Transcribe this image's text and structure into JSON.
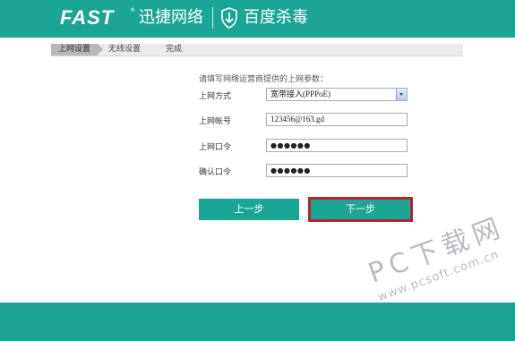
{
  "header": {
    "logo": "FAST",
    "trademark": "®",
    "brand_cn": "迅捷网络",
    "partner": "百度杀毒",
    "color": "#1aa595"
  },
  "steps": [
    "上网设置",
    "无线设置",
    "完成"
  ],
  "instruction": "请填写网络运营商提供的上网参数：",
  "form": {
    "mode_label": "上网方式",
    "mode_value": "宽带接入(PPPoE)",
    "account_label": "上网帐号",
    "account_value": "123456@163.gd",
    "password_label": "上网口令",
    "password_value": "●●●●●●",
    "confirm_label": "确认口令",
    "confirm_value": "●●●●●●"
  },
  "buttons": {
    "prev": "上一步",
    "next": "下一步"
  },
  "watermark": {
    "line1": "PC下载网",
    "line2": "www.pcsoft.com.cn"
  },
  "colors": {
    "accent": "#1aa595",
    "highlight_border": "#b32630"
  }
}
